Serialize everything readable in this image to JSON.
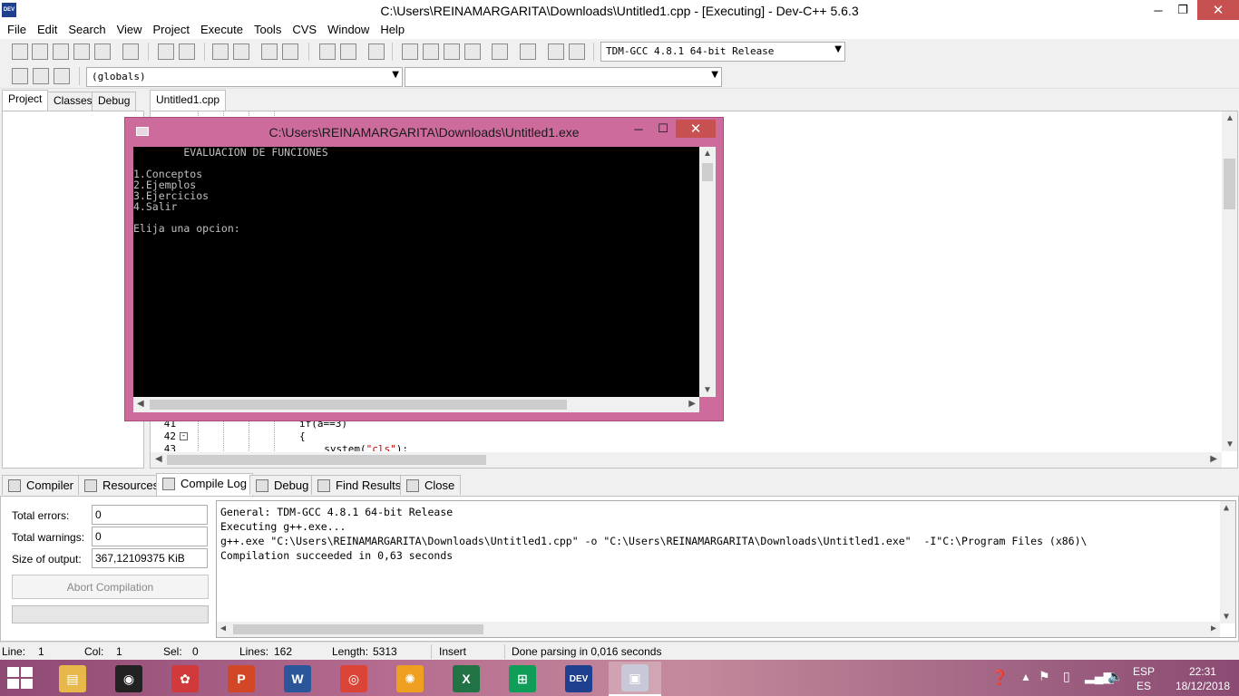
{
  "window": {
    "title": "C:\\Users\\REINAMARGARITA\\Downloads\\Untitled1.cpp - [Executing] - Dev-C++ 5.6.3",
    "app_icon_text": "DEV",
    "minimize": "─",
    "maximize": "❐",
    "close": "✕"
  },
  "menu": [
    "File",
    "Edit",
    "Search",
    "View",
    "Project",
    "Execute",
    "Tools",
    "CVS",
    "Window",
    "Help"
  ],
  "toolbar": {
    "compiler_select": "TDM-GCC 4.8.1 64-bit Release",
    "scope_select": "(globals)",
    "member_select": ""
  },
  "left_panel": {
    "tabs": [
      "Project",
      "Classes",
      "Debug"
    ]
  },
  "editor": {
    "tab": "Untitled1.cpp",
    "lines": [
      {
        "num": "41",
        "code": "if(a==3)",
        "str": ""
      },
      {
        "num": "42",
        "code": "{",
        "str": ""
      },
      {
        "num": "43",
        "code": "  system(",
        "str": "\"cls\"",
        "tail": ");"
      }
    ]
  },
  "console": {
    "title": "C:\\Users\\REINAMARGARITA\\Downloads\\Untitled1.exe",
    "output": "        EVALUACION DE FUNCIONES\n\n1.Conceptos\n2.Ejemplos\n3.Ejercicios\n4.Salir\n\nElija una opcion:",
    "minimize": "─",
    "maximize": "☐",
    "close": "✕"
  },
  "bottom_tabs": [
    "Compiler",
    "Resources",
    "Compile Log",
    "Debug",
    "Find Results",
    "Close"
  ],
  "compile_stats": {
    "errors_label": "Total errors:",
    "errors_value": "0",
    "warnings_label": "Total warnings:",
    "warnings_value": "0",
    "size_label": "Size of output:",
    "size_value": "367,12109375 KiB",
    "abort_button": "Abort Compilation"
  },
  "compile_log": [
    "General: TDM-GCC 4.8.1 64-bit Release",
    "Executing g++.exe...",
    "g++.exe \"C:\\Users\\REINAMARGARITA\\Downloads\\Untitled1.cpp\" -o \"C:\\Users\\REINAMARGARITA\\Downloads\\Untitled1.exe\"  -I\"C:\\Program Files (x86)\\",
    "Compilation succeeded in 0,63 seconds"
  ],
  "status_bar": {
    "line_label": "Line:",
    "line_value": "1",
    "col_label": "Col:",
    "col_value": "1",
    "sel_label": "Sel:",
    "sel_value": "0",
    "lines_label": "Lines:",
    "lines_value": "162",
    "length_label": "Length:",
    "length_value": "5313",
    "mode": "Insert",
    "message": "Done parsing in 0,016 seconds"
  },
  "taskbar": {
    "apps": [
      {
        "name": "File Explorer",
        "icon": "folder-icon",
        "color": "#e8b84a",
        "glyph": "▤"
      },
      {
        "name": "Camera",
        "icon": "camera-icon",
        "color": "#222222",
        "glyph": "◉"
      },
      {
        "name": "Paint app",
        "icon": "paint-icon",
        "color": "#d03a3a",
        "glyph": "✿"
      },
      {
        "name": "PowerPoint",
        "icon": "powerpoint-icon",
        "color": "#d24726",
        "glyph": "P"
      },
      {
        "name": "Word",
        "icon": "word-icon",
        "color": "#2b579a",
        "glyph": "W"
      },
      {
        "name": "Chrome",
        "icon": "chrome-icon",
        "color": "#db4437",
        "glyph": "◎"
      },
      {
        "name": "Settings",
        "icon": "gear-icon",
        "color": "#f0a020",
        "glyph": "✺"
      },
      {
        "name": "Excel",
        "icon": "excel-icon",
        "color": "#217346",
        "glyph": "X"
      },
      {
        "name": "Store",
        "icon": "store-icon",
        "color": "#0f9d58",
        "glyph": "⊞"
      },
      {
        "name": "Dev-C++",
        "icon": "devcpp-icon",
        "color": "#1f3f8f",
        "glyph": "DEV"
      },
      {
        "name": "Console",
        "icon": "console-icon",
        "color": "#c8c8d8",
        "glyph": "▣"
      }
    ],
    "lang_top": "ESP",
    "lang_bottom": "ES",
    "time": "22:31",
    "date": "18/12/2018"
  }
}
